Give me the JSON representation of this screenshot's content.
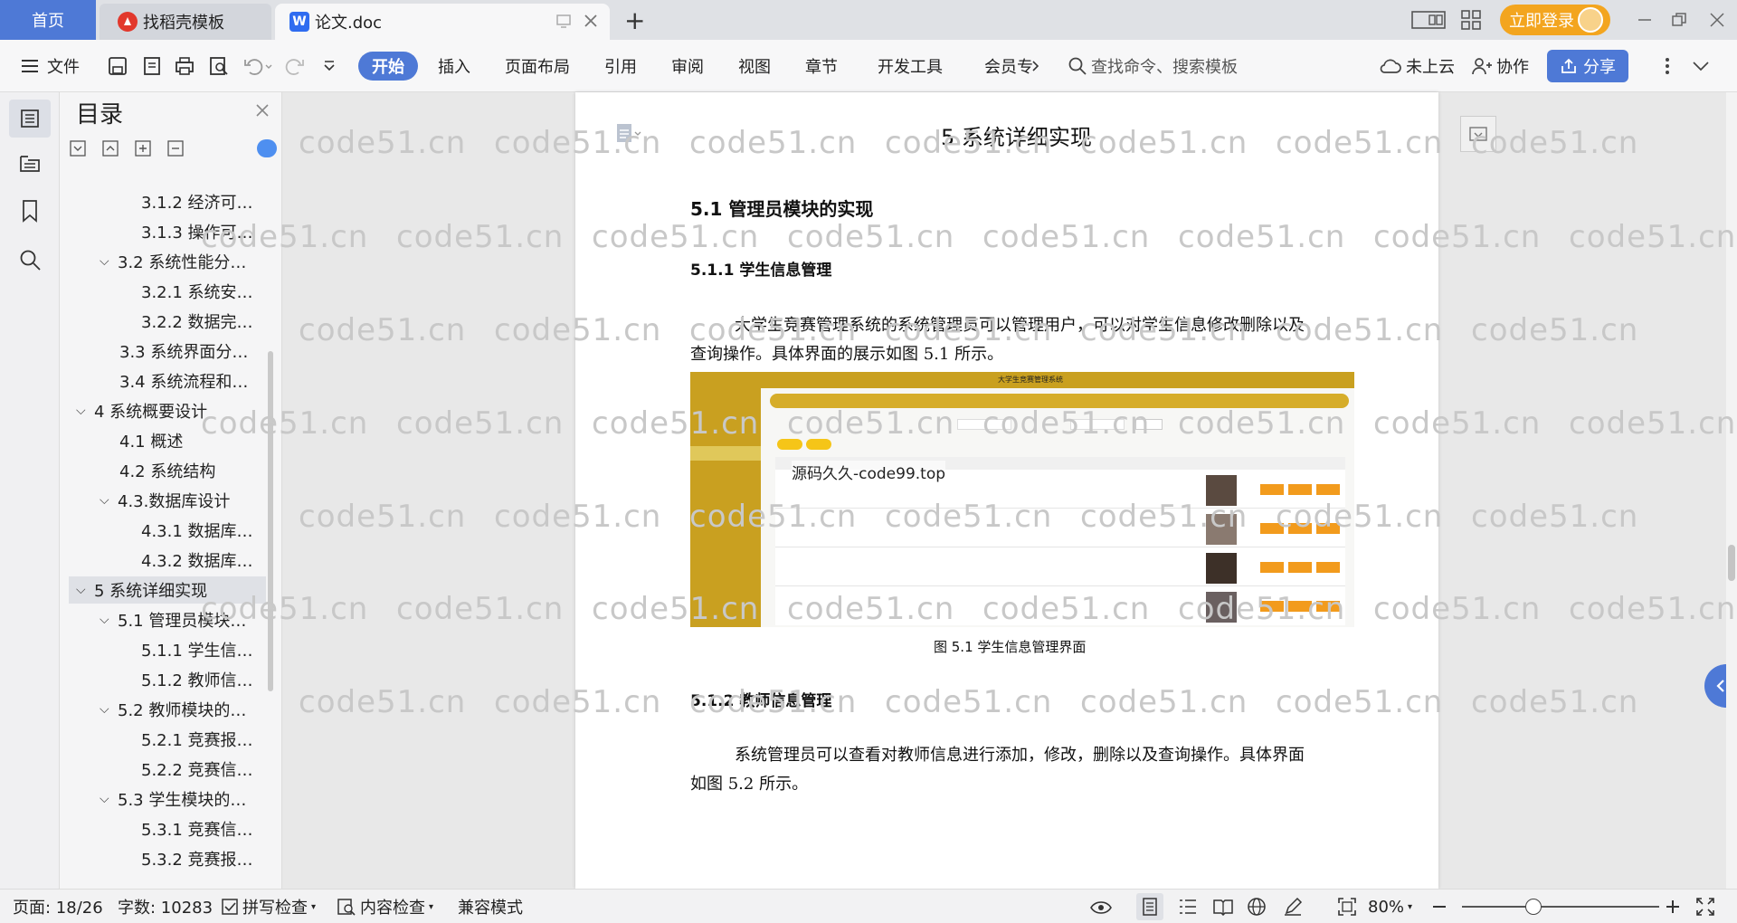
{
  "tabs": {
    "home": "首页",
    "docer": "找稻壳模板",
    "doc": "论文.doc",
    "new_tab": "+"
  },
  "titlebar": {
    "login": "立即登录"
  },
  "toolbar": {
    "file": "文件",
    "menus": [
      "开始",
      "插入",
      "页面布局",
      "引用",
      "审阅",
      "视图",
      "章节",
      "开发工具",
      "会员专"
    ],
    "search_placeholder": "查找命令、搜索模板",
    "cloud": "未上云",
    "collab": "协作",
    "share": "分享"
  },
  "toc": {
    "title": "目录",
    "items": [
      {
        "label": "3.1.2 经济可…",
        "level": 3,
        "expanded": null
      },
      {
        "label": "3.1.3 操作可…",
        "level": 3,
        "expanded": null
      },
      {
        "label": "3.2 系统性能分…",
        "level": 2,
        "expanded": true
      },
      {
        "label": "3.2.1  系统安…",
        "level": 3,
        "expanded": null
      },
      {
        "label": "3.2.2  数据完…",
        "level": 3,
        "expanded": null
      },
      {
        "label": "3.3 系统界面分…",
        "level": 2,
        "expanded": null
      },
      {
        "label": "3.4 系统流程和…",
        "level": 2,
        "expanded": null
      },
      {
        "label": "4 系统概要设计",
        "level": 1,
        "expanded": true
      },
      {
        "label": "4.1 概述",
        "level": 2,
        "expanded": null
      },
      {
        "label": "4.2 系统结构",
        "level": 2,
        "expanded": null
      },
      {
        "label": "4.3.数据库设计",
        "level": 2,
        "expanded": true
      },
      {
        "label": "4.3.1 数据库…",
        "level": 3,
        "expanded": null
      },
      {
        "label": "4.3.2 数据库…",
        "level": 3,
        "expanded": null
      },
      {
        "label": "5 系统详细实现",
        "level": 1,
        "expanded": true,
        "selected": true
      },
      {
        "label": "5.1  管理员模块…",
        "level": 2,
        "expanded": true
      },
      {
        "label": "5.1.1  学生信…",
        "level": 3,
        "expanded": null
      },
      {
        "label": "5.1.2  教师信…",
        "level": 3,
        "expanded": null
      },
      {
        "label": "5.2  教师模块的…",
        "level": 2,
        "expanded": true
      },
      {
        "label": "5.2.1  竞赛报…",
        "level": 3,
        "expanded": null
      },
      {
        "label": "5.2.2  竞赛信…",
        "level": 3,
        "expanded": null
      },
      {
        "label": "5.3  学生模块的…",
        "level": 2,
        "expanded": true
      },
      {
        "label": "5.3.1  竞赛信…",
        "level": 3,
        "expanded": null
      },
      {
        "label": "5.3.2  竞赛报…",
        "level": 3,
        "expanded": null
      }
    ]
  },
  "watermark": "code51.cn",
  "document": {
    "chapter_title": "5 系统详细实现",
    "h2": "5.1  管理员模块的实现",
    "h3_1": "5.1.1  学生信息管理",
    "p1_line1": "大学生竞赛管理系统的系统管理员可以管理用户，可以对学生信息修改删除以及",
    "p1_line2": "查询操作。具体界面的展示如图 5.1 所示。",
    "figure_caption": "图 5.1  学生信息管理界面",
    "h3_2": "5.1.2  教师信息管理",
    "p2_line1": "系统管理员可以查看对教师信息进行添加，修改，删除以及查询操作。具体界面",
    "p2_line2": "如图 5.2 所示。"
  },
  "figure": {
    "app_title": "大学生竞赛管理系统",
    "overlay_text": "源码久久-code99.top",
    "colors": {
      "gold": "#c9a020",
      "orange": "#f29b1d"
    }
  },
  "status": {
    "page": "页面: 18/26",
    "words": "字数: 10283",
    "spell": "拼写检查",
    "content_check": "内容检查",
    "compat": "兼容模式",
    "zoom": "80%"
  }
}
